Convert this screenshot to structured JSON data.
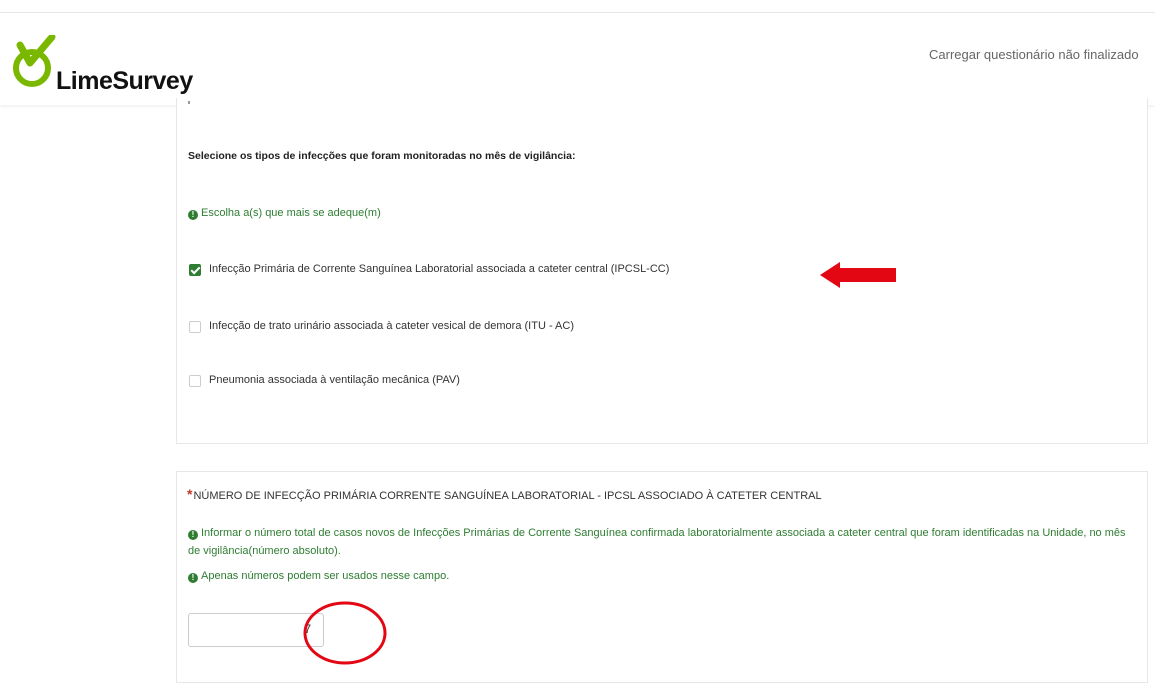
{
  "header": {
    "logo_text": "LimeSurvey",
    "load_link": "Carregar questionário não finalizado"
  },
  "question1": {
    "title": "Selecione os tipos de infecções que foram monitoradas no mês de vigilância:",
    "help": "Escolha a(s) que mais se adeque(m)",
    "options": [
      {
        "label": "Infecção Primária de Corrente Sanguínea Laboratorial associada a cateter central (IPCSL-CC)",
        "checked": true
      },
      {
        "label": "Infecção de trato urinário associada à cateter vesical de demora (ITU - AC)",
        "checked": false
      },
      {
        "label": "Pneumonia associada à ventilação mecânica (PAV)",
        "checked": false
      }
    ]
  },
  "question2": {
    "required_mark": "*",
    "title": "NÚMERO DE INFECÇÃO PRIMÁRIA CORRENTE SANGUÍNEA LABORATORIAL - IPCSL ASSOCIADO À CATETER CENTRAL",
    "help": "Informar o número total de casos novos de Infecções Primárias de Corrente Sanguínea confirmada laboratorialmente associada a cateter central que foram identificadas na Unidade, no mês de vigilância(número absoluto).",
    "help_numbers": "Apenas números podem ser usados nesse campo.",
    "input_value": "7"
  },
  "colors": {
    "accent_green": "#2e7d32",
    "annotation_red": "#e30613",
    "logo_green": "#7ab800"
  },
  "icons": {
    "help": "exclamation-circle-icon",
    "annotation_arrow": "left-arrow-icon",
    "annotation_circle": "circle-highlight-icon"
  }
}
